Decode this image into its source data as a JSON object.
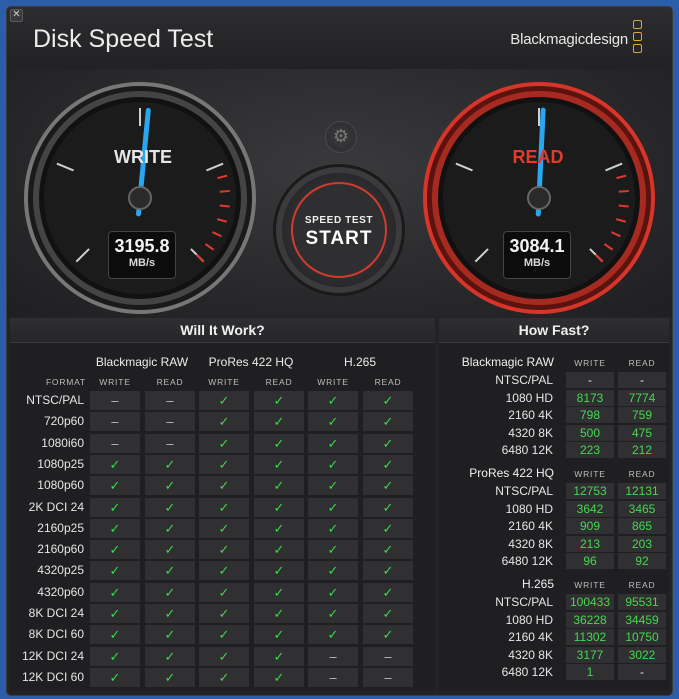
{
  "app": {
    "title": "Disk Speed Test",
    "brand": "Blackmagicdesign",
    "close_glyph": "✕",
    "accent_color": "#d23b2e",
    "needle_color": "#2aa6f0",
    "ok_color": "#3bd84a"
  },
  "write_gauge": {
    "label": "WRITE",
    "value": "3195.8",
    "unit": "MB/s",
    "needle_fraction": 0.52
  },
  "read_gauge": {
    "label": "READ",
    "value": "3084.1",
    "unit": "MB/s",
    "needle_fraction": 0.51
  },
  "controls": {
    "settings_icon": "gear-icon",
    "gear_glyph": "⚙",
    "start_line1": "SPEED TEST",
    "start_line2": "START"
  },
  "will_it_work": {
    "title": "Will It Work?",
    "format_label": "FORMAT",
    "codecs": [
      "Blackmagic RAW",
      "ProRes 422 HQ",
      "H.265"
    ],
    "col_labels": [
      "WRITE",
      "READ"
    ],
    "symbols": {
      "ok": "✓",
      "no": "–"
    },
    "rows": [
      {
        "label": "NTSC/PAL",
        "cells": [
          "no",
          "no",
          "ok",
          "ok",
          "ok",
          "ok"
        ]
      },
      {
        "label": "720p60",
        "cells": [
          "no",
          "no",
          "ok",
          "ok",
          "ok",
          "ok"
        ]
      },
      {
        "label": "1080i60",
        "cells": [
          "no",
          "no",
          "ok",
          "ok",
          "ok",
          "ok"
        ]
      },
      {
        "label": "1080p25",
        "cells": [
          "ok",
          "ok",
          "ok",
          "ok",
          "ok",
          "ok"
        ]
      },
      {
        "label": "1080p60",
        "cells": [
          "ok",
          "ok",
          "ok",
          "ok",
          "ok",
          "ok"
        ]
      },
      {
        "label": "2K DCI 24",
        "cells": [
          "ok",
          "ok",
          "ok",
          "ok",
          "ok",
          "ok"
        ]
      },
      {
        "label": "2160p25",
        "cells": [
          "ok",
          "ok",
          "ok",
          "ok",
          "ok",
          "ok"
        ]
      },
      {
        "label": "2160p60",
        "cells": [
          "ok",
          "ok",
          "ok",
          "ok",
          "ok",
          "ok"
        ]
      },
      {
        "label": "4320p25",
        "cells": [
          "ok",
          "ok",
          "ok",
          "ok",
          "ok",
          "ok"
        ]
      },
      {
        "label": "4320p60",
        "cells": [
          "ok",
          "ok",
          "ok",
          "ok",
          "ok",
          "ok"
        ]
      },
      {
        "label": "8K DCI 24",
        "cells": [
          "ok",
          "ok",
          "ok",
          "ok",
          "ok",
          "ok"
        ]
      },
      {
        "label": "8K DCI 60",
        "cells": [
          "ok",
          "ok",
          "ok",
          "ok",
          "ok",
          "ok"
        ]
      },
      {
        "label": "12K DCI 24",
        "cells": [
          "ok",
          "ok",
          "ok",
          "ok",
          "no",
          "no"
        ]
      },
      {
        "label": "12K DCI 60",
        "cells": [
          "ok",
          "ok",
          "ok",
          "ok",
          "no",
          "no"
        ]
      }
    ]
  },
  "how_fast": {
    "title": "How Fast?",
    "col_labels": [
      "WRITE",
      "READ"
    ],
    "groups": [
      {
        "name": "Blackmagic RAW",
        "rows": [
          {
            "label": "NTSC/PAL",
            "write": "-",
            "read": "-"
          },
          {
            "label": "1080 HD",
            "write": "8173",
            "read": "7774"
          },
          {
            "label": "2160 4K",
            "write": "798",
            "read": "759"
          },
          {
            "label": "4320 8K",
            "write": "500",
            "read": "475"
          },
          {
            "label": "6480 12K",
            "write": "223",
            "read": "212"
          }
        ]
      },
      {
        "name": "ProRes 422 HQ",
        "rows": [
          {
            "label": "NTSC/PAL",
            "write": "12753",
            "read": "12131"
          },
          {
            "label": "1080 HD",
            "write": "3642",
            "read": "3465"
          },
          {
            "label": "2160 4K",
            "write": "909",
            "read": "865"
          },
          {
            "label": "4320 8K",
            "write": "213",
            "read": "203"
          },
          {
            "label": "6480 12K",
            "write": "96",
            "read": "92"
          }
        ]
      },
      {
        "name": "H.265",
        "rows": [
          {
            "label": "NTSC/PAL",
            "write": "100433",
            "read": "95531"
          },
          {
            "label": "1080 HD",
            "write": "36228",
            "read": "34459"
          },
          {
            "label": "2160 4K",
            "write": "11302",
            "read": "10750"
          },
          {
            "label": "4320 8K",
            "write": "3177",
            "read": "3022"
          },
          {
            "label": "6480 12K",
            "write": "1",
            "read": "-"
          }
        ]
      }
    ]
  }
}
